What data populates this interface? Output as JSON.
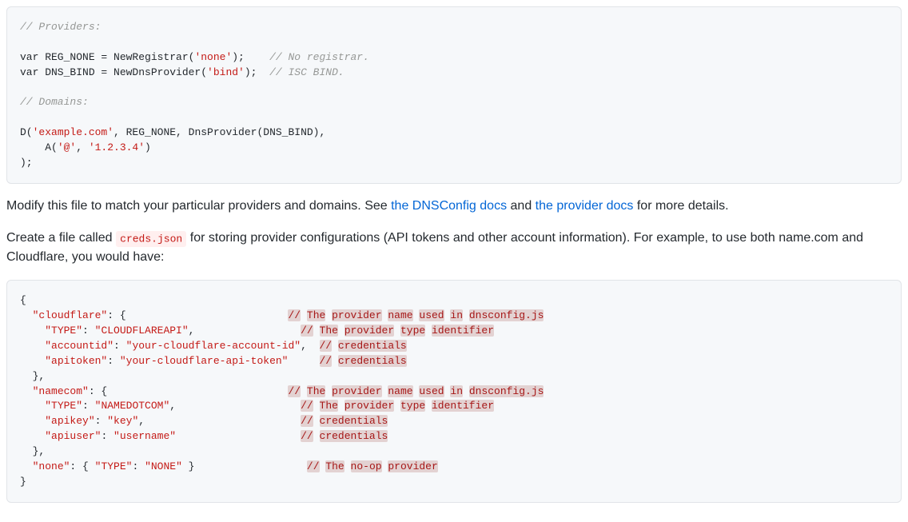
{
  "codeblock1": {
    "c_providers": "// Providers:",
    "line1_pre": "var REG_NONE = NewRegistrar(",
    "line1_str": "'none'",
    "line1_post": ");    ",
    "line1_c": "// No registrar.",
    "line2_pre": "var DNS_BIND = NewDnsProvider(",
    "line2_str": "'bind'",
    "line2_post": ");  ",
    "line2_c": "// ISC BIND.",
    "c_domains": "// Domains:",
    "d_open": "D(",
    "d_str1": "'example.com'",
    "d_mid": ", REG_NONE, DnsProvider(DNS_BIND),",
    "a_pre": "    A(",
    "a_str1": "'@'",
    "a_comma": ", ",
    "a_str2": "'1.2.3.4'",
    "a_post": ")",
    "close": ");"
  },
  "para1": {
    "t1": "Modify this file to match your particular providers and domains. See ",
    "link1": "the DNSConfig docs",
    "t2": " and ",
    "link2": "the provider docs",
    "t3": " for more details."
  },
  "para2": {
    "t1": "Create a file called ",
    "code": "creds.json",
    "t2": " for storing provider configurations (API tokens and other account information). For example, to use both name.com and Cloudflare, you would have:"
  },
  "codeblock2": {
    "l01": "{",
    "l02a": "  ",
    "l02s": "\"cloudflare\"",
    "l02b": ": {                          ",
    "l02e1": "//",
    "l02e2": " ",
    "l02e3": "The",
    "l02e4": " ",
    "l02e5": "provider",
    "l02e6": " ",
    "l02e7": "name",
    "l02e8": " ",
    "l02e9": "used",
    "l02e10": " ",
    "l02e11": "in",
    "l02e12": " ",
    "l02e13": "dnsconfig.js",
    "l03a": "    ",
    "l03s1": "\"TYPE\"",
    "l03b": ": ",
    "l03s2": "\"CLOUDFLAREAPI\"",
    "l03c": ",                 ",
    "l03e1": "//",
    "l03e2": " ",
    "l03e3": "The",
    "l03e4": " ",
    "l03e5": "provider",
    "l03e6": " ",
    "l03e7": "type",
    "l03e8": " ",
    "l03e9": "identifier",
    "l04a": "    ",
    "l04s1": "\"accountid\"",
    "l04b": ": ",
    "l04s2": "\"your-cloudflare-account-id\"",
    "l04c": ",  ",
    "l04e1": "//",
    "l04e2": " ",
    "l04e3": "credentials",
    "l05a": "    ",
    "l05s1": "\"apitoken\"",
    "l05b": ": ",
    "l05s2": "\"your-cloudflare-api-token\"",
    "l05c": "     ",
    "l05e1": "//",
    "l05e2": " ",
    "l05e3": "credentials",
    "l06": "  },",
    "l07a": "  ",
    "l07s": "\"namecom\"",
    "l07b": ": {                             ",
    "l07e1": "//",
    "l07e2": " ",
    "l07e3": "The",
    "l07e4": " ",
    "l07e5": "provider",
    "l07e6": " ",
    "l07e7": "name",
    "l07e8": " ",
    "l07e9": "used",
    "l07e10": " ",
    "l07e11": "in",
    "l07e12": " ",
    "l07e13": "dnsconfig.js",
    "l08a": "    ",
    "l08s1": "\"TYPE\"",
    "l08b": ": ",
    "l08s2": "\"NAMEDOTCOM\"",
    "l08c": ",                    ",
    "l08e1": "//",
    "l08e2": " ",
    "l08e3": "The",
    "l08e4": " ",
    "l08e5": "provider",
    "l08e6": " ",
    "l08e7": "type",
    "l08e8": " ",
    "l08e9": "identifier",
    "l09a": "    ",
    "l09s1": "\"apikey\"",
    "l09b": ": ",
    "l09s2": "\"key\"",
    "l09c": ",                         ",
    "l09e1": "//",
    "l09e2": " ",
    "l09e3": "credentials",
    "l10a": "    ",
    "l10s1": "\"apiuser\"",
    "l10b": ": ",
    "l10s2": "\"username\"",
    "l10c": "                    ",
    "l10e1": "//",
    "l10e2": " ",
    "l10e3": "credentials",
    "l11": "  },",
    "l12a": "  ",
    "l12s1": "\"none\"",
    "l12b": ": { ",
    "l12s2": "\"TYPE\"",
    "l12c": ": ",
    "l12s3": "\"NONE\"",
    "l12d": " }                  ",
    "l12e1": "//",
    "l12e2": " ",
    "l12e3": "The",
    "l12e4": " ",
    "l12e5": "no-op",
    "l12e6": " ",
    "l12e7": "provider",
    "l13": "}"
  }
}
